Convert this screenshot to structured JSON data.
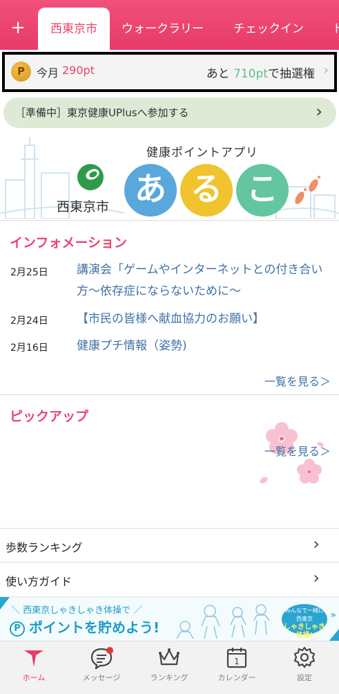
{
  "colors": {
    "accent": "#ea4570",
    "link": "#3f72a8",
    "green_value": "#5fbf8e",
    "uplus_bg": "#dfead6",
    "nav_active": "#e63c67"
  },
  "tabs": {
    "add_label": "+",
    "items": [
      {
        "label": "西東京市",
        "active": true
      },
      {
        "label": "ウォークラリー",
        "active": false
      },
      {
        "label": "チェックイン",
        "active": false
      },
      {
        "label": "ト",
        "active": false
      }
    ]
  },
  "points": {
    "coin_letter": "P",
    "this_month_label": "今月",
    "this_month_value": "290pt",
    "remaining_prefix": "あと",
    "remaining_value": "710pt",
    "remaining_suffix": "で抽選権",
    "chevron": "›"
  },
  "uplus": {
    "text": "［準備中］東京健康UPlusへ参加する",
    "chevron": "›"
  },
  "hero": {
    "tagline": "健康ポイントアプリ",
    "city_name": "西東京市",
    "logo_chars": [
      "あ",
      "る",
      "こ"
    ]
  },
  "information": {
    "title": "インフォメーション",
    "items": [
      {
        "date": "2月25日",
        "text": "講演会「ゲームやインターネットとの付き合い方～依存症にならないために～"
      },
      {
        "date": "2月24日",
        "text": "【市民の皆様へ献血協力のお願い】"
      },
      {
        "date": "2月16日",
        "text": "健康プチ情報（姿勢)"
      }
    ],
    "more_label": "一覧を見る＞"
  },
  "pickup": {
    "title": "ピックアップ",
    "more_label": "一覧を見る＞"
  },
  "menu_rows": [
    {
      "label": "歩数ランキング",
      "chevron": "›"
    },
    {
      "label": "使い方ガイド",
      "chevron": "›"
    }
  ],
  "promo": {
    "top_text": "＼ 西東京しゃきしゃき体操で ／",
    "main_text": "ポイントを貯めよう!",
    "p_icon": "P",
    "badge_line1": "みんなで一緒に",
    "badge_line2": "西東京",
    "badge_line3": "しゃきしゃき体操!",
    "arrow": "»"
  },
  "bottom_nav": [
    {
      "label": "ホーム",
      "icon": "home-arrow-icon",
      "active": true
    },
    {
      "label": "メッセージ",
      "icon": "message-bubble-icon",
      "active": false
    },
    {
      "label": "ランキング",
      "icon": "crown-icon",
      "active": false
    },
    {
      "label": "カレンダー",
      "icon": "calendar-icon",
      "active": false
    },
    {
      "label": "設定",
      "icon": "gear-icon",
      "active": false
    }
  ],
  "calendar_day": "1"
}
